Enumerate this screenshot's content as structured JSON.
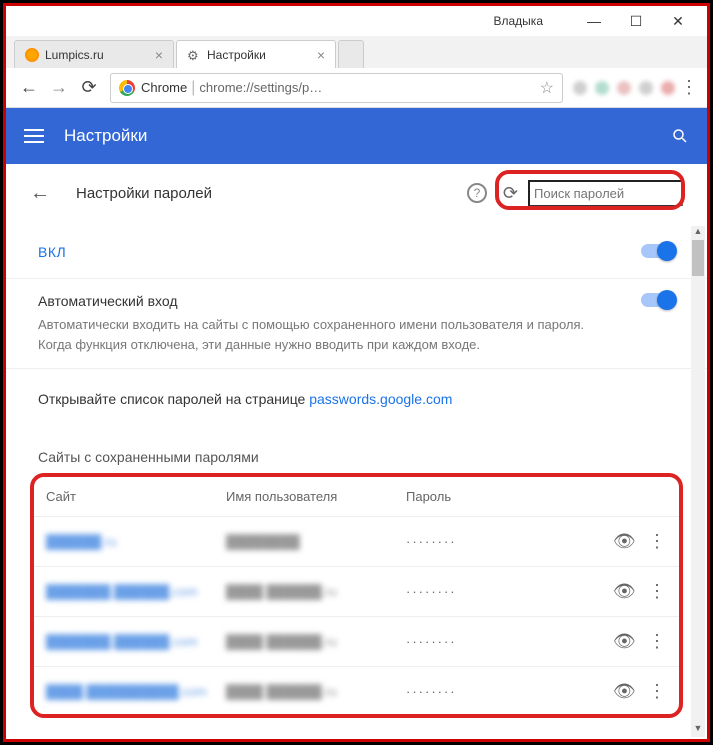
{
  "window": {
    "user": "Владыка"
  },
  "tabs": [
    {
      "label": "Lumpics.ru"
    },
    {
      "label": "Настройки"
    }
  ],
  "addressbar": {
    "secure_label": "Chrome",
    "url": "chrome://settings/p…"
  },
  "header": {
    "title": "Настройки"
  },
  "sub": {
    "title": "Настройки паролей",
    "search_placeholder": "Поиск паролей"
  },
  "on_label": "ВКЛ",
  "auto": {
    "heading": "Автоматический вход",
    "desc": "Автоматически входить на сайты с помощью сохраненного имени пользователя и пароля. Когда функция отключена, эти данные нужно вводить при каждом входе."
  },
  "link_row": {
    "prefix": "Открывайте список паролей на странице ",
    "link": "passwords.google.com"
  },
  "saved_heading": "Сайты с сохраненными паролями",
  "table": {
    "cols": {
      "site": "Сайт",
      "user": "Имя пользователя",
      "pass": "Пароль"
    },
    "rows": [
      {
        "site": "██████.ru",
        "user": "████████",
        "pass": "········"
      },
      {
        "site": "███████.██████.com",
        "user": "████ ██████.ru",
        "pass": "········"
      },
      {
        "site": "███████.██████.com",
        "user": "████ ██████.ru",
        "pass": "········"
      },
      {
        "site": "████.██████████.com",
        "user": "████ ██████.ru",
        "pass": "········"
      }
    ]
  }
}
